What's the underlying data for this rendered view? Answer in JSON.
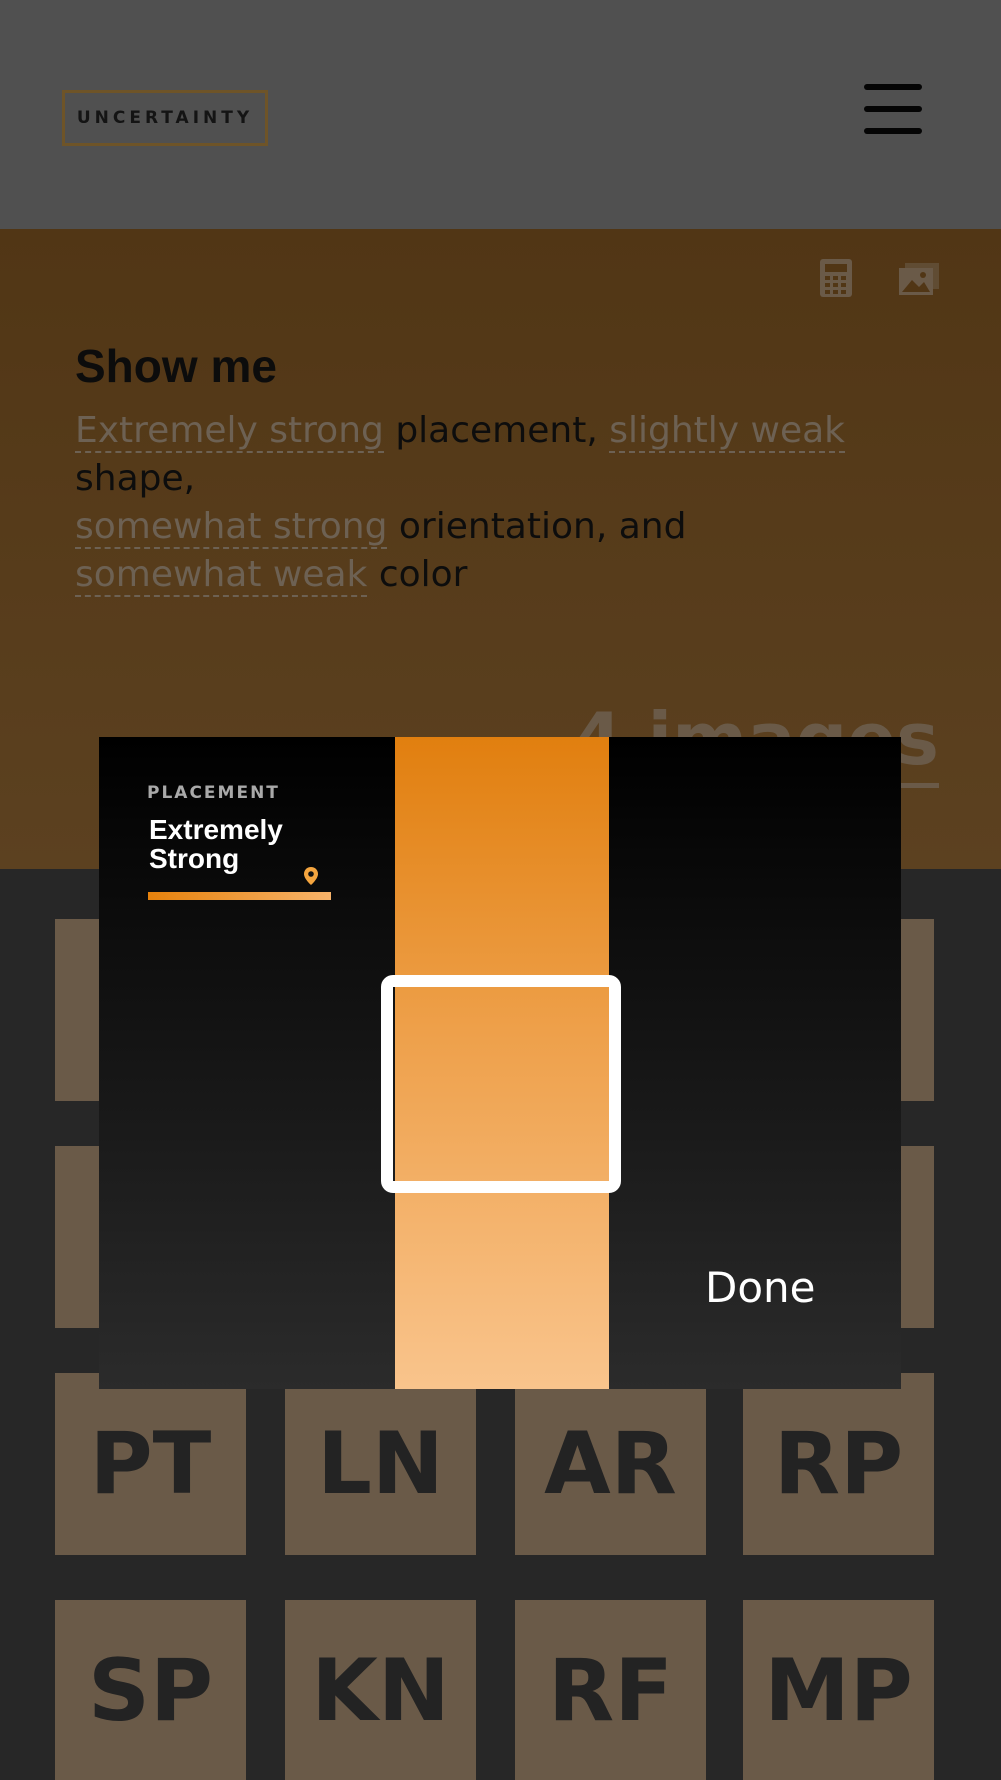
{
  "header": {
    "brand": "UNCERTAINTY",
    "menu_icon": "hamburger-menu-icon"
  },
  "hero": {
    "calc_icon": "calculator-icon",
    "image_icon": "image-icon",
    "title": "Show me",
    "sentence": {
      "level_placement": "Extremely strong",
      "text_placement": " placement, ",
      "level_shape": "slightly weak",
      "text_shape": " shape, ",
      "level_orientation": "somewhat strong",
      "text_orientation": " orientation, and ",
      "level_color": "somewhat weak",
      "text_color": " color"
    },
    "image_count": "4 images"
  },
  "grid": {
    "tiles": [
      "PT",
      "LN",
      "AR",
      "RP",
      "SP",
      "KN",
      "RF",
      "MP"
    ]
  },
  "picker": {
    "label": "PLACEMENT",
    "value": "Extremely Strong",
    "pin_icon": "location-pin-icon",
    "done_label": "Done",
    "level": "Extremely Strong",
    "colors": {
      "strip_top": "#e17f0f",
      "strip_bottom": "#f9c48c",
      "hero_bg": "#533816",
      "tile_bg": "#6a5a48"
    }
  }
}
